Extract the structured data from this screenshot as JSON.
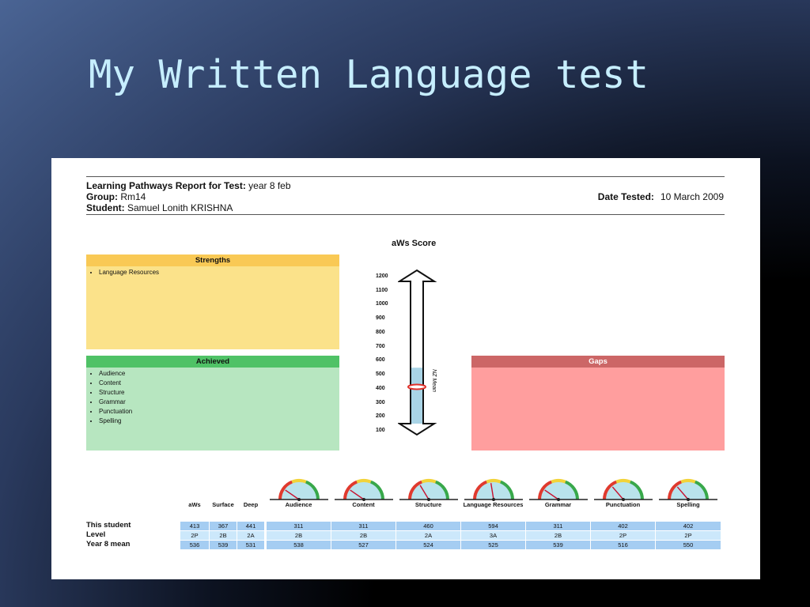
{
  "slide_title": "My Written Language test",
  "report": {
    "title_label": "Learning Pathways Report for Test:",
    "title_value": "year 8 feb",
    "group_label": "Group:",
    "group_value": "Rm14",
    "student_label": "Student:",
    "student_value": "Samuel Lonith KRISHNA",
    "date_label": "Date Tested:",
    "date_value": "10 March 2009"
  },
  "strengths": {
    "heading": "Strengths",
    "items": [
      "Language Resources"
    ],
    "head_color": "#f9c955",
    "body_color": "#fbe28a"
  },
  "achieved": {
    "heading": "Achieved",
    "items": [
      "Audience",
      "Content",
      "Structure",
      "Grammar",
      "Punctuation",
      "Spelling"
    ],
    "head_color": "#4fc266",
    "body_color": "#b7e6c0"
  },
  "gaps": {
    "heading": "Gaps",
    "items": [],
    "head_color": "#cc6666",
    "body_color": "#ff9e9e"
  },
  "score_chart": {
    "title": "aWs Score",
    "ticks": [
      "1200",
      "1100",
      "1000",
      "900",
      "800",
      "700",
      "600",
      "500",
      "400",
      "300",
      "200",
      "100"
    ],
    "min": 100,
    "max": 1200,
    "student_score": 550,
    "mean_label": "NZ Mean",
    "mean_value": 413,
    "fill_color": "#a9d4e6",
    "marker_color": "#e0302a"
  },
  "table": {
    "headers": [
      "aWs",
      "Surface",
      "Deep",
      "Audience",
      "Content",
      "Structure",
      "Language Resources",
      "Grammar",
      "Punctuation",
      "Spelling"
    ],
    "rows": [
      {
        "label": "This student",
        "values": [
          "413",
          "367",
          "441",
          "311",
          "311",
          "460",
          "594",
          "311",
          "402",
          "402"
        ],
        "color": "#a5cdf2"
      },
      {
        "label": "Level",
        "values": [
          "2P",
          "2B",
          "2A",
          "2B",
          "2B",
          "2A",
          "3A",
          "2B",
          "2P",
          "2P"
        ],
        "color": "#cce8fb"
      },
      {
        "label": "Year 8 mean",
        "values": [
          "536",
          "539",
          "531",
          "538",
          "527",
          "524",
          "525",
          "539",
          "516",
          "550"
        ],
        "color": "#a5cdf2"
      }
    ]
  }
}
